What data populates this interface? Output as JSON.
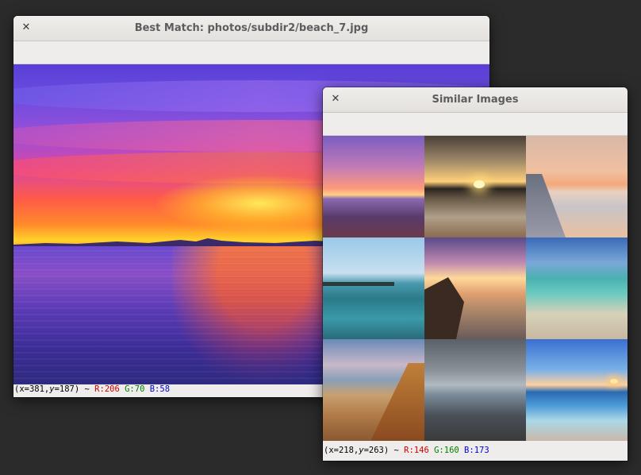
{
  "main_window": {
    "close_icon": "close-icon",
    "title": "Best Match: photos/subdir2/beach_7.jpg",
    "image_name": "beach_7.jpg",
    "status": {
      "prefix": "(x=381,",
      "y_label": "y",
      "y_value": "=187) ~ ",
      "r_label": "R:206",
      "g_label": "G:70",
      "b_label": "B:58"
    }
  },
  "similar_window": {
    "close_icon": "close-icon",
    "title": "Similar Images",
    "status": {
      "prefix": "(x=218,",
      "y_label": "y",
      "y_value": "=263) ~ ",
      "r_label": "R:146",
      "g_label": "G:160",
      "b_label": "B:173"
    },
    "thumbnails": [
      {
        "row": 1,
        "col": 1,
        "desc": "purple-sunset-beach"
      },
      {
        "row": 1,
        "col": 2,
        "desc": "golden-sunset-shore"
      },
      {
        "row": 1,
        "col": 3,
        "desc": "peach-tidal-flat"
      },
      {
        "row": 2,
        "col": 1,
        "desc": "turquoise-sea-breakwater"
      },
      {
        "row": 2,
        "col": 2,
        "desc": "sunburst-rocky-cove"
      },
      {
        "row": 2,
        "col": 3,
        "desc": "aqua-sandy-beach"
      },
      {
        "row": 3,
        "col": 1,
        "desc": "dune-grass-coast"
      },
      {
        "row": 3,
        "col": 2,
        "desc": "stormy-rocky-shore"
      },
      {
        "row": 3,
        "col": 3,
        "desc": "blue-wave-sunset"
      }
    ]
  },
  "colors": {
    "desktop": "#2b2b2b",
    "titlebar": "#e8e6e3",
    "r_text": "#d40000",
    "g_text": "#008000",
    "b_text": "#0000d4"
  }
}
